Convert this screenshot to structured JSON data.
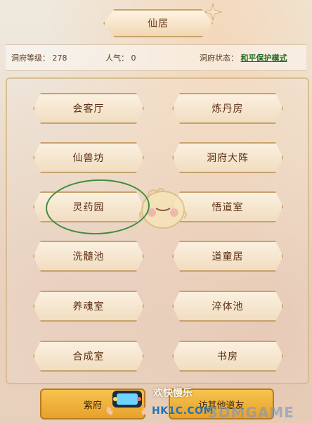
{
  "title": "仙居",
  "info": {
    "level_label": "洞府等级：",
    "level_value": "278",
    "popularity_label": "人气：",
    "popularity_value": "0",
    "status_label": "洞府状态：",
    "status_value": "和平保护模式"
  },
  "buildings": [
    {
      "label": "会客厅"
    },
    {
      "label": "炼丹房"
    },
    {
      "label": "仙兽坊"
    },
    {
      "label": "洞府大阵"
    },
    {
      "label": "灵药园"
    },
    {
      "label": "悟道室"
    },
    {
      "label": "洗髓池"
    },
    {
      "label": "道童居"
    },
    {
      "label": "养魂室"
    },
    {
      "label": "淬体池"
    },
    {
      "label": "合成室"
    },
    {
      "label": "书房"
    }
  ],
  "bottom": {
    "left_label": "紫府",
    "right_label": "访其他道友"
  },
  "watermark": {
    "top_text": "欢快慢乐",
    "site": "HK1C.COM",
    "brand": "3DMGAME"
  },
  "colors": {
    "button_text": "#5b2f14",
    "status_green": "#226b25",
    "highlight_circle": "#3f8d3f",
    "bottom_tab": "#f6c44e"
  },
  "icons": {
    "mascot": "chick-mascot-icon",
    "sparkle": "sparkle-icon",
    "watermark_phone": "game-controller-phone-icon"
  }
}
